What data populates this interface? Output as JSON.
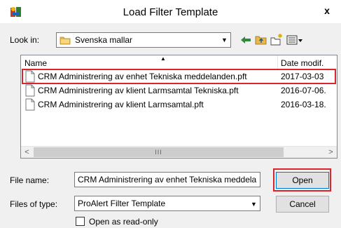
{
  "window": {
    "title": "Load Filter Template",
    "close_glyph": "x"
  },
  "look_in": {
    "label": "Look in:",
    "value": "Svenska mallar"
  },
  "toolbar_icons": [
    "back-arrow-icon",
    "up-folder-icon",
    "new-folder-icon",
    "view-menu-icon"
  ],
  "file_list": {
    "columns": {
      "name": "Name",
      "date": "Date modif."
    },
    "rows": [
      {
        "name": "CRM Administrering av enhet Tekniska meddelanden.pft",
        "date": "2017-03-03"
      },
      {
        "name": "CRM Administrering av klient Larmsamtal Tekniska.pft",
        "date": "2016-07-06."
      },
      {
        "name": "CRM Administrering av klient Larmsamtal.pft",
        "date": "2016-03-18."
      }
    ],
    "scrollbar": {
      "left": "<",
      "right": ">",
      "thumb": "III"
    }
  },
  "file_name": {
    "label": "File name:",
    "value": "CRM Administrering av enhet Tekniska meddela"
  },
  "files_of_type": {
    "label": "Files of type:",
    "value": "ProAlert Filter Template"
  },
  "buttons": {
    "open": "Open",
    "cancel": "Cancel"
  },
  "read_only": {
    "label": "Open as read-only"
  },
  "colors": {
    "highlight": "#d9262e",
    "dialog_bg": "#f0f0f0"
  }
}
